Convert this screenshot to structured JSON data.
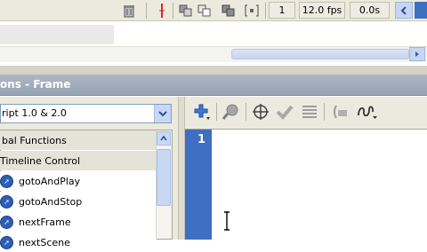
{
  "timeline": {
    "frame_number": "1",
    "fps": "12.0 fps",
    "elapsed": "0.0s"
  },
  "panel": {
    "title": "ons - Frame"
  },
  "language": {
    "selected": "ript 1.0 & 2.0"
  },
  "toolbox": {
    "items": [
      {
        "label": "bal Functions",
        "type": "category"
      },
      {
        "label": "Timeline Control",
        "type": "category"
      },
      {
        "label": "gotoAndPlay",
        "type": "action"
      },
      {
        "label": "gotoAndStop",
        "type": "action"
      },
      {
        "label": "nextFrame",
        "type": "action"
      },
      {
        "label": "nextScene",
        "type": "action"
      }
    ]
  },
  "editor": {
    "line_number": "1"
  },
  "colors": {
    "gutter": "#3f6fc2",
    "panel_title": "#97a3b3",
    "toolbar_bg": "#eceadf"
  }
}
